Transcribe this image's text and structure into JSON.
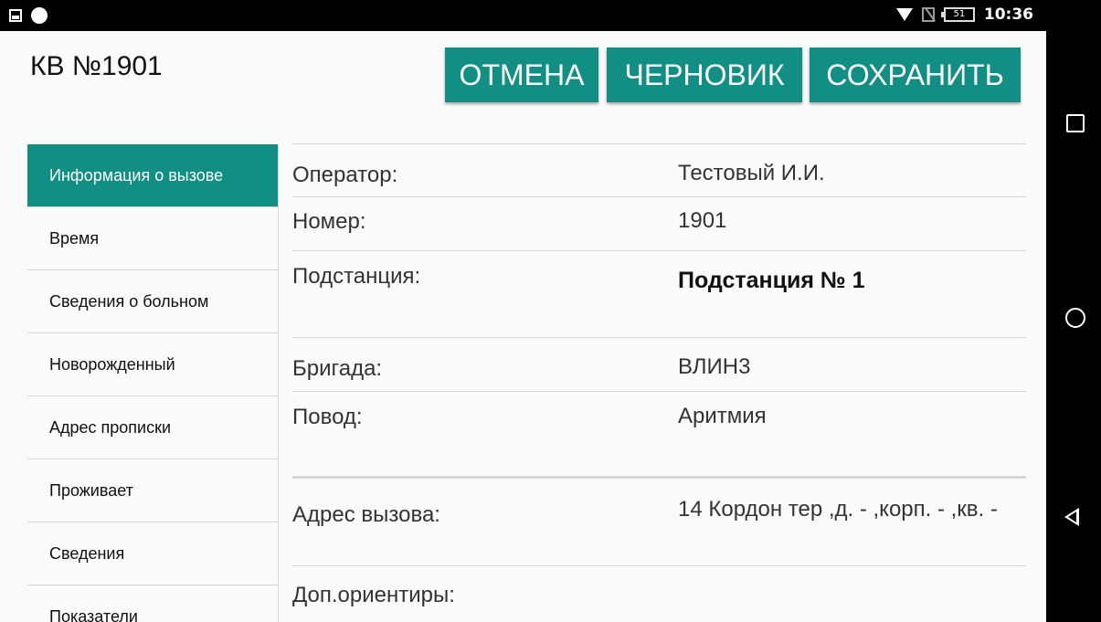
{
  "status_bar": {
    "time": "10:36",
    "battery": "51"
  },
  "header": {
    "title": "КВ №1901",
    "buttons": {
      "cancel": "ОТМЕНА",
      "draft": "ЧЕРНОВИК",
      "save": "СОХРАНИТЬ"
    }
  },
  "sidebar": {
    "items": [
      {
        "label": "Информация о вызове"
      },
      {
        "label": "Время"
      },
      {
        "label": "Сведения о больном"
      },
      {
        "label": "Новорожденный"
      },
      {
        "label": "Адрес прописки"
      },
      {
        "label": "Проживает"
      },
      {
        "label": "Сведения"
      },
      {
        "label": "Показатели"
      }
    ]
  },
  "fields": [
    {
      "label": "Оператор:",
      "value": "Тестовый И.И."
    },
    {
      "label": "Номер:",
      "value": "1901"
    },
    {
      "label": "Подстанция:",
      "value": "Подстанция № 1"
    },
    {
      "label": "Бригада:",
      "value": "ВЛИН3"
    },
    {
      "label": "Повод:",
      "value": "Аритмия"
    },
    {
      "label": "Адрес вызова:",
      "value": "14 Кордон тер ,д. - ,корп. - ,кв. -"
    },
    {
      "label": "Доп.ориентиры:",
      "value": ""
    }
  ],
  "colors": {
    "accent": "#128f84"
  },
  "icons": {
    "nav_recent": "square-icon",
    "nav_home": "circle-icon",
    "nav_back": "triangle-back-icon"
  }
}
